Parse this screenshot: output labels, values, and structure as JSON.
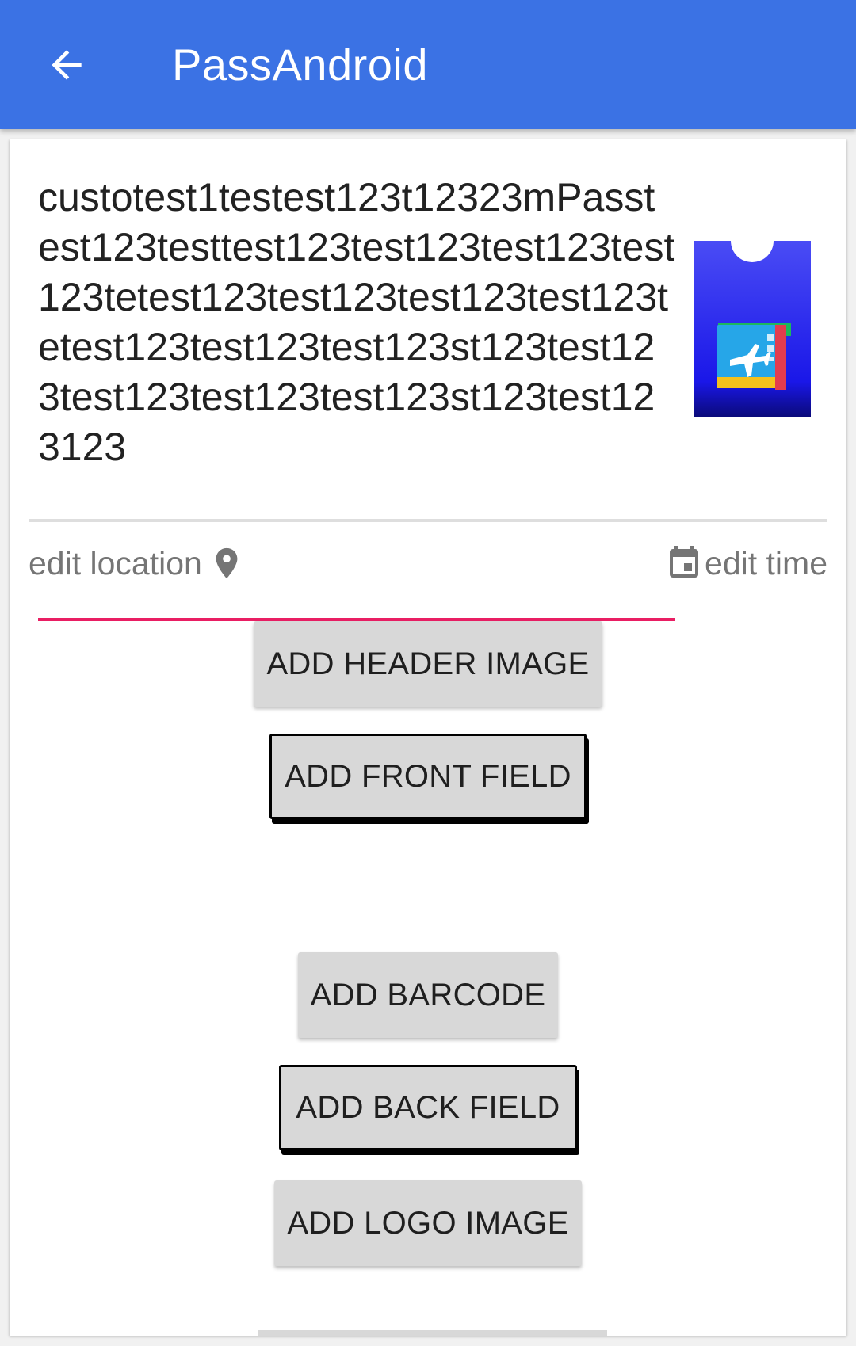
{
  "app_bar": {
    "title": "PassAndroid",
    "back_icon": "arrow-back-icon",
    "color": "#3b72e4"
  },
  "pass": {
    "description": "custotest1testest123t12323mPasstest123testtest123test123test123test123tetest123test123test123test123tetest123test123test123st123test123test123test123test123st123test123123",
    "icon": "boarding-pass-icon",
    "underline_color": "#e91e63"
  },
  "location": {
    "label": "edit location",
    "icon": "location-pin-icon"
  },
  "time": {
    "label": "edit time",
    "icon": "calendar-icon"
  },
  "buttons": {
    "add_header_image": "ADD HEADER IMAGE",
    "add_front_field": "ADD FRONT FIELD",
    "add_barcode": "ADD BARCODE",
    "add_back_field": "ADD BACK FIELD",
    "add_logo_image": "ADD LOGO IMAGE"
  }
}
